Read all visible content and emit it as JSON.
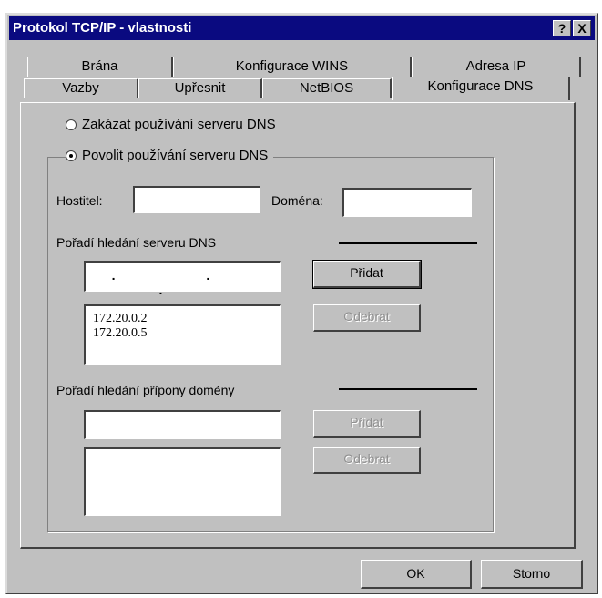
{
  "window": {
    "title": "Protokol TCP/IP - vlastnosti",
    "help_label": "?",
    "close_label": "X"
  },
  "tabs": {
    "row1": [
      "Brána",
      "Konfigurace WINS",
      "Adresa IP"
    ],
    "row2": [
      "Vazby",
      "Upřesnit",
      "NetBIOS",
      "Konfigurace DNS"
    ],
    "active": "Konfigurace DNS"
  },
  "dns": {
    "disable_label": "Zakázat používání serveru DNS",
    "enable_label": "Povolit používání serveru DNS",
    "enabled": true,
    "host_label": "Hostitel:",
    "host_value": "",
    "domain_label": "Doména:",
    "domain_value": "",
    "server_order_label": "Pořadí hledání serveru DNS",
    "server_ip_input": ". . .",
    "servers": [
      "172.20.0.2",
      "172.20.0.5"
    ],
    "add_label": "Přidat",
    "remove_label": "Odebrat",
    "suffix_order_label": "Pořadí hledání přípony domény",
    "suffix_value": "",
    "suffix_add_label": "Přidat",
    "suffix_remove_label": "Odebrat"
  },
  "footer": {
    "ok_label": "OK",
    "cancel_label": "Storno"
  }
}
